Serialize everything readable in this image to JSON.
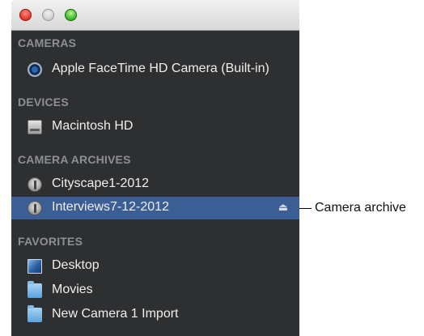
{
  "window": {
    "traffic_lights": [
      "close",
      "minimize",
      "zoom"
    ]
  },
  "sidebar": {
    "sections": [
      {
        "header": "CAMERAS",
        "items": [
          {
            "label": "Apple FaceTime HD Camera (Built-in)",
            "icon": "camera-icon"
          }
        ]
      },
      {
        "header": "DEVICES",
        "items": [
          {
            "label": "Macintosh HD",
            "icon": "hard-drive-icon"
          }
        ]
      },
      {
        "header": "CAMERA ARCHIVES",
        "items": [
          {
            "label": "Cityscape1-2012",
            "icon": "camera-archive-icon"
          },
          {
            "label": "Interviews7-12-2012",
            "icon": "camera-archive-icon",
            "selected": true,
            "eject": "⏏"
          }
        ]
      },
      {
        "header": "FAVORITES",
        "items": [
          {
            "label": "Desktop",
            "icon": "desktop-icon"
          },
          {
            "label": "Movies",
            "icon": "folder-icon"
          },
          {
            "label": "New Camera 1 Import",
            "icon": "folder-icon"
          }
        ]
      }
    ]
  },
  "callout": {
    "label": "Camera archive"
  },
  "colors": {
    "sidebar_bg": "#2e2f31",
    "selection": "#3b5f95",
    "header_text": "#8d8f93"
  }
}
